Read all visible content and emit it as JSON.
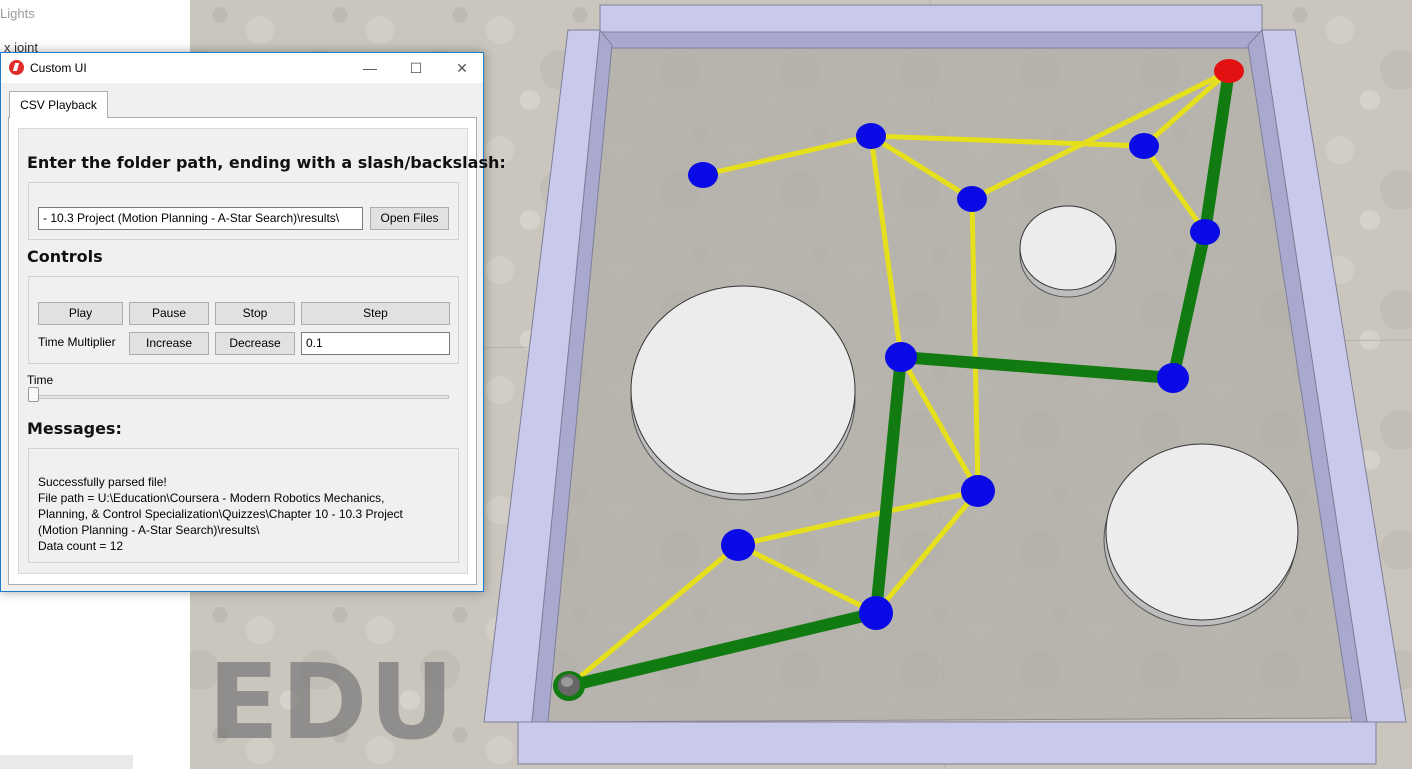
{
  "background_panel": {
    "items": [
      "Lights",
      "x joint"
    ]
  },
  "watermark": "EDU",
  "window": {
    "title": "Custom UI",
    "controls": {
      "minimize": "—",
      "maximize": "☐",
      "close": "✕"
    },
    "tabs": [
      {
        "label": "CSV Playback",
        "active": true
      }
    ],
    "folder_section": {
      "heading": "Enter the folder path, ending with a slash/backslash:",
      "path_value": "- 10.3 Project (Motion Planning - A-Star Search)\\results\\",
      "open_button": "Open Files"
    },
    "controls_section": {
      "heading": "Controls",
      "buttons": {
        "play": "Play",
        "pause": "Pause",
        "stop": "Stop",
        "step": "Step"
      },
      "time_multiplier_label": "Time Multiplier",
      "increase": "Increase",
      "decrease": "Decrease",
      "multiplier_value": "0.1"
    },
    "time_section": {
      "label": "Time",
      "position": 0.0
    },
    "messages_section": {
      "heading": "Messages:",
      "text": "Successfully parsed file!\nFile path = U:\\Education\\Coursera - Modern Robotics Mechanics,\nPlanning, & Control Specialization\\Quizzes\\Chapter 10 - 10.3 Project\n(Motion Planning - A-Star Search)\\results\\\nData count = 12"
    }
  },
  "scene": {
    "colors": {
      "floor": "#b9b5ad",
      "wall": "#c8c8ec",
      "edge": "#e6df1c",
      "path": "#117a11",
      "node": "#0a0ae6",
      "goal": "#e31111",
      "start": "#117a11",
      "obstacle": "#ececec"
    }
  }
}
